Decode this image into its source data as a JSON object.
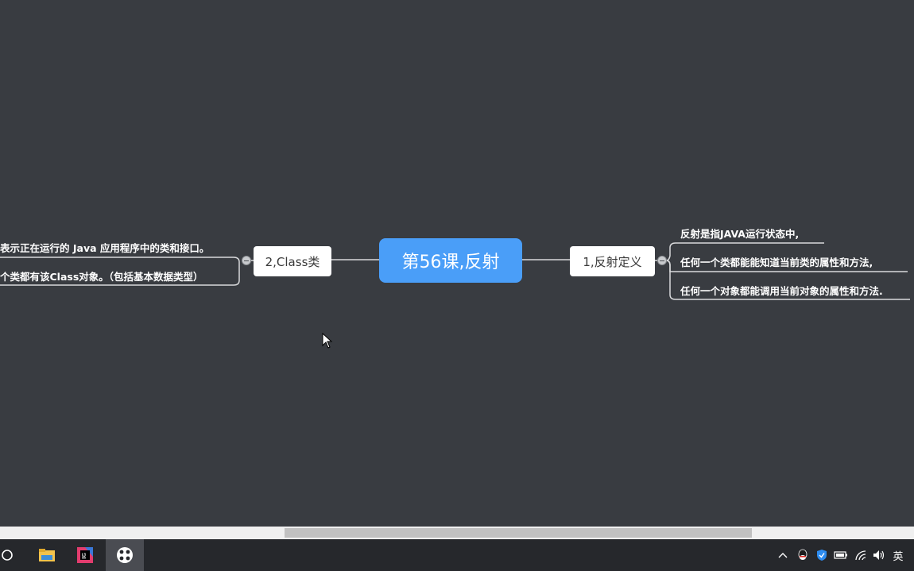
{
  "mindmap": {
    "central": "第56课,反射",
    "right_branch": {
      "label": "1,反射定义",
      "leaves": [
        "反射是指JAVA运行状态中,",
        "任何一个类都能能知道当前类的属性和方法,",
        "任何一个对象都能调用当前对象的属性和方法."
      ]
    },
    "left_branch": {
      "label": "2,Class类",
      "leaves": [
        "表示正在运行的 Java 应用程序中的类和接口。",
        "个类都有该Class对象。（包括基本数据类型）"
      ]
    }
  },
  "colors": {
    "canvas_bg": "#393c41",
    "central_node": "#4a9ef8",
    "node_bg": "#ffffff",
    "line": "#d9dadc",
    "taskbar_bg": "#26282c"
  },
  "taskbar": {
    "apps": [
      "search-icon",
      "file-explorer-icon",
      "intellij-idea-icon",
      "xmind-icon"
    ],
    "tray": {
      "icons": [
        "chevron-up-icon",
        "qq-icon",
        "shield-icon",
        "battery-icon",
        "wifi-icon",
        "volume-icon"
      ],
      "language": "英"
    }
  }
}
